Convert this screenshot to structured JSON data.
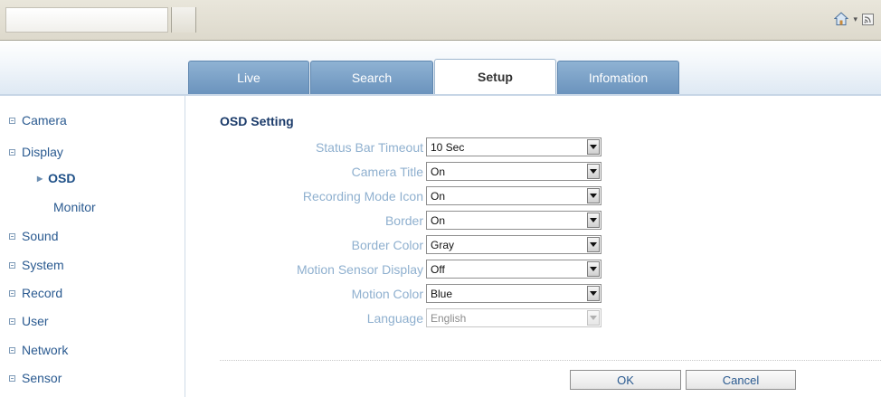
{
  "tabs": [
    {
      "label": "Live"
    },
    {
      "label": "Search"
    },
    {
      "label": "Setup"
    },
    {
      "label": "Infomation"
    }
  ],
  "sidebar": {
    "items": [
      {
        "label": "Camera"
      },
      {
        "label": "Display"
      },
      {
        "label": "OSD"
      },
      {
        "label": "Monitor"
      },
      {
        "label": "Sound"
      },
      {
        "label": "System"
      },
      {
        "label": "Record"
      },
      {
        "label": "User"
      },
      {
        "label": "Network"
      },
      {
        "label": "Sensor"
      }
    ]
  },
  "main": {
    "title": "OSD Setting",
    "settings": [
      {
        "label": "Status Bar Timeout",
        "value": "10 Sec"
      },
      {
        "label": "Camera Title",
        "value": "On"
      },
      {
        "label": "Recording Mode Icon",
        "value": "On"
      },
      {
        "label": "Border",
        "value": "On"
      },
      {
        "label": "Border Color",
        "value": "Gray"
      },
      {
        "label": "Motion Sensor Display",
        "value": "Off"
      },
      {
        "label": "Motion Color",
        "value": "Blue"
      },
      {
        "label": "Language",
        "value": "English",
        "disabled": true
      }
    ],
    "ok_label": "OK",
    "cancel_label": "Cancel"
  },
  "icons": {
    "home": "home-icon",
    "dropdown": "chevron-down-icon",
    "feed": "feed-icon"
  },
  "colors": {
    "tab_blue": "#7ea3c8",
    "nav_text": "#2a5a90",
    "label_text": "#8fb0cf"
  }
}
